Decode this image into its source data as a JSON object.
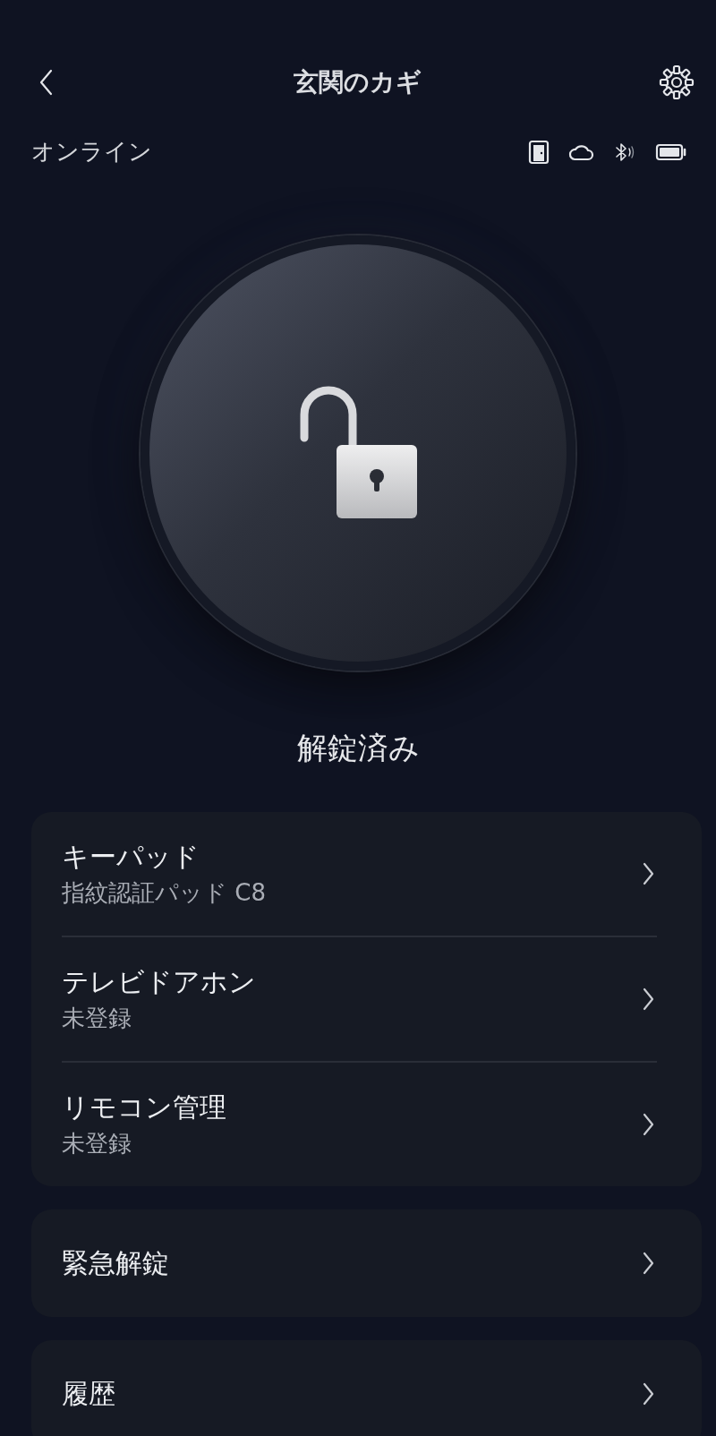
{
  "header": {
    "title": "玄関のカギ"
  },
  "connection": {
    "label": "オンライン"
  },
  "lock": {
    "locked": false,
    "status": "解錠済み"
  },
  "groups": [
    {
      "items": [
        {
          "title": "キーパッド",
          "subtitle": "指紋認証パッド C8"
        },
        {
          "title": "テレビドアホン",
          "subtitle": "未登録"
        },
        {
          "title": "リモコン管理",
          "subtitle": "未登録"
        }
      ]
    },
    {
      "items": [
        {
          "title": "緊急解錠"
        }
      ]
    },
    {
      "items": [
        {
          "title": "履歴"
        }
      ]
    }
  ]
}
